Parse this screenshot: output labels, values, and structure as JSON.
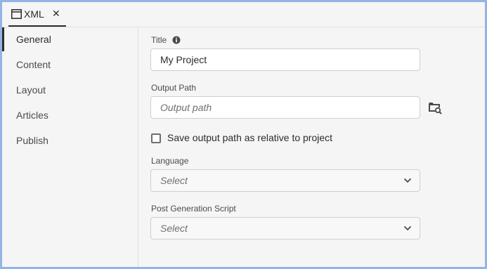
{
  "tab": {
    "label": "XML",
    "close": "✕"
  },
  "sidebar": {
    "items": [
      {
        "label": "General",
        "selected": true
      },
      {
        "label": "Content"
      },
      {
        "label": "Layout"
      },
      {
        "label": "Articles"
      },
      {
        "label": "Publish"
      }
    ]
  },
  "form": {
    "title": {
      "label": "Title",
      "value": "My Project"
    },
    "output_path": {
      "label": "Output Path",
      "placeholder": "Output path"
    },
    "relative_checkbox": {
      "label": "Save output path as relative to project",
      "checked": false
    },
    "language": {
      "label": "Language",
      "value": "Select"
    },
    "post_script": {
      "label": "Post Generation Script",
      "value": "Select"
    }
  },
  "colors": {
    "frame_border": "#93b4e6",
    "background": "#f5f5f5",
    "field_bg": "#ffffff",
    "text": "#2c2c2c"
  },
  "icons": {
    "tab": "window-icon",
    "info": "info-icon",
    "browse": "folder-search-icon",
    "dropdown": "chevron-down-icon"
  }
}
